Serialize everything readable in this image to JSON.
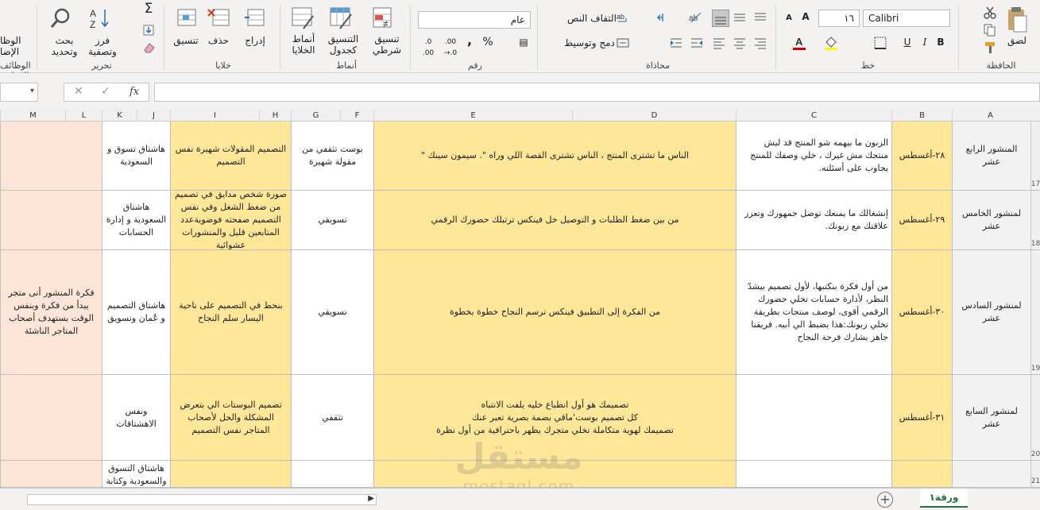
{
  "ribbon": {
    "groups": {
      "clipboard": "الحافظة",
      "font": "خط",
      "alignment": "محاذاة",
      "number": "رقم",
      "styles": "أنماط",
      "cells": "خلايا",
      "editing": "تحرير",
      "functions": "الوظائف الإضافية"
    },
    "paste_label": "لصق",
    "font_name": "Calibri",
    "font_size": "١٦",
    "wrap_text": "التفاف النص",
    "merge_center": "دمج وتوسيط",
    "number_format": "عام",
    "conditional_format": "تنسيق شرطي",
    "format_as_table": "التنسيق كجدول",
    "cell_styles": "أنماط الخلايا",
    "insert": "إدراج",
    "delete": "حذف",
    "format": "تنسيق",
    "sort_filter": "فرز وتصفية",
    "find_select": "بحث وتحديد",
    "addins_1": "الوظا",
    "addins_2": "الإضا"
  },
  "formula_bar": {
    "fx": "fx",
    "value": ""
  },
  "columns": [
    "A",
    "B",
    "C",
    "D",
    "E",
    "F",
    "G",
    "H",
    "I",
    "J",
    "K",
    "L",
    "M"
  ],
  "rows": [
    {
      "num": "17",
      "A": "المنشور الرابع عشر",
      "B": "٢٨-أغسطس",
      "C": "الزبون ما بيهمه شو المنتج قد ليش منتجك مش غيرك ، خلي وصفك للمنتج يجاوب على أسئلته.",
      "E": "الناس ما تشترى المنتج ، الناس تشترى القصة اللي وراه \". سيمون سينك \"",
      "G": "بوست تثقفي من مقولة شهيرة",
      "I": "التصميم المقولات شهيرة نفس التصميم",
      "K": "هاشتاق تسوق و السعودية",
      "M": ""
    },
    {
      "num": "18",
      "A": "لمنشور الخامس عشر",
      "B": "٢٩-أغسطس",
      "C": "إنشغالك ما يمنعك توصل جمهورك وتعزز علاقتك مع زبونك.",
      "E": "من بين ضغط الطلبات و التوصيل خل فينكس ترتبلك حضورك الرقمي",
      "G": "تسويقي",
      "I": "صورة شخص مدايق في تصميم من ضغط الشغل وفي نفس التصميم صفحته فوضويةعدد المتابعين قليل والمنشورات عشوائية",
      "K": "هاشتاق السعودية و إدارة الحسابات",
      "M": ""
    },
    {
      "num": "19",
      "A": "لمنشور السادس عشر",
      "B": "٣٠-أغسطس",
      "C": "من أول فكرة بنكتبها، لأول تصميم بيشدّ النظر، لأدارة حسابات تخلي حضورك الرقمي أقوى، لوصف منتجات بطريقة تخلي زبونك:هذا بضبط الي أبيه.      فريقنا جاهز يشارك فرحة النجاح",
      "E": "من الفكرة إلى التطبيق  فينكس ترسم النجاح خطوة بخطوة",
      "G": "تسويقي",
      "I": "بنحط في التصميم على ناحية اليسار سلم النجاح",
      "K": "هاشتاق التصميم و عُمان وتسويق",
      "M": "فكرة المنشور أنى متجر يبدأ من فكرة وبنفس الوقت بستهدف أصحاب المتاجر الناشئة"
    },
    {
      "num": "20",
      "A": "لمنشور السابع عشر",
      "B": "٣١-أغسطس",
      "C": "",
      "E": "تصميمك هو أول انطباع خليه يلفت الانتباه\nكل تصميم بوست'ماقي بصمة بصرية تعبر عنك\nتصميمك لهوية متكاملة تخلي متجرك يظهر باحترافية من أول نظرة",
      "G": "تثقفي",
      "I": "تصميم البوستات الي بتعرض المشكلة والحل لأصحاب المتاجر نفس التصميم",
      "K": "ونفس الاهشتاقات",
      "M": ""
    },
    {
      "num": "21",
      "A": "",
      "B": "",
      "C": "",
      "E": "",
      "G": "",
      "I": "",
      "K": "هاشتاق التسوق والسعودية وكتابة",
      "M": ""
    }
  ],
  "sheet_tab": "ورقة١",
  "watermark": {
    "ar": "مستقل",
    "en": "mostaql.com"
  },
  "colors": {
    "yellow": "#ffe699",
    "pink": "#fce4d6",
    "ribbon": "#f3f2f1"
  }
}
